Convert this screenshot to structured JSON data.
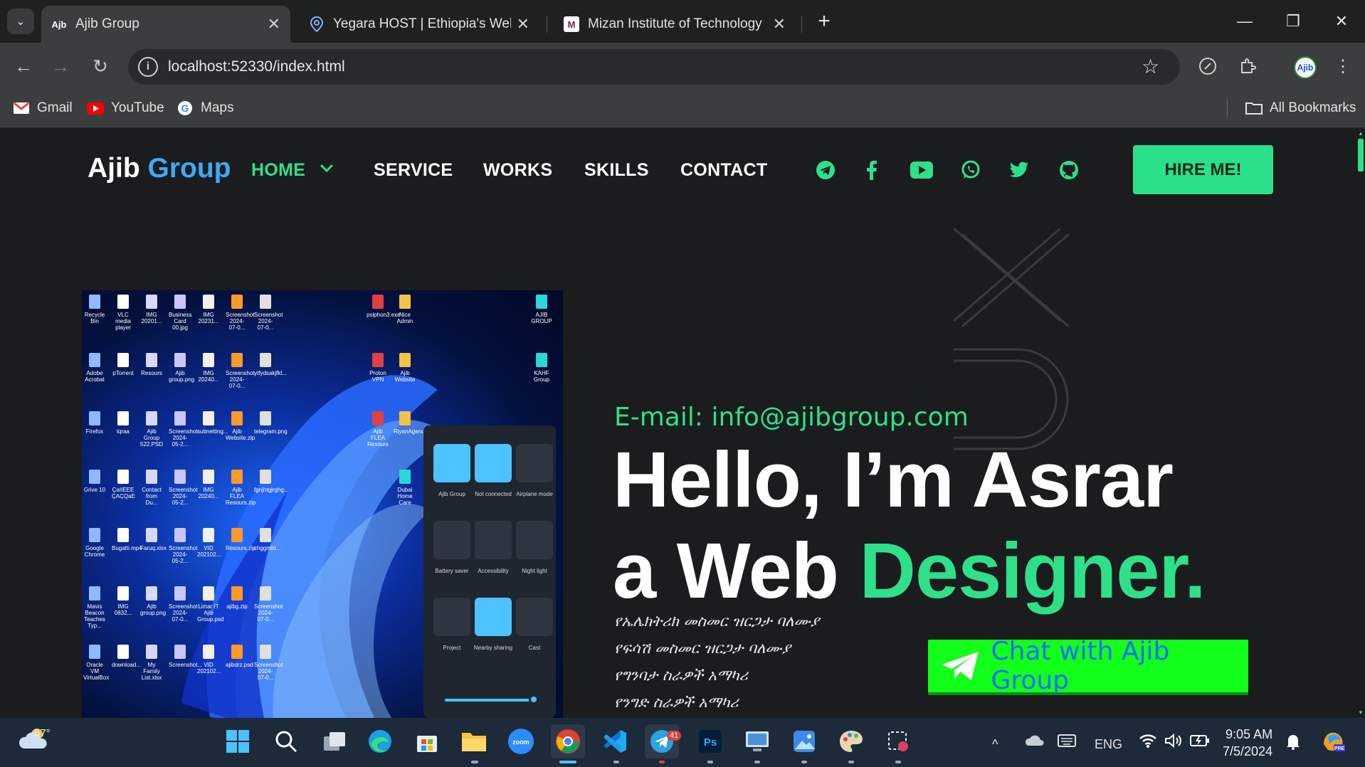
{
  "browser": {
    "tabs": [
      {
        "title": "Ajib Group",
        "active": true,
        "favicon": "ajib-favicon"
      },
      {
        "title": "Yegara HOST | Ethiopia's Web H",
        "active": false,
        "favicon": "location-pin-icon"
      },
      {
        "title": "Mizan Institute of Technology -",
        "active": false,
        "favicon": "mizan-favicon"
      }
    ],
    "url": "localhost:52330/index.html",
    "profile_label": "Ajib",
    "bookmarks": [
      {
        "label": "Gmail",
        "icon": "gmail-icon"
      },
      {
        "label": "YouTube",
        "icon": "youtube-icon"
      },
      {
        "label": "Maps",
        "icon": "google-icon"
      }
    ],
    "all_bookmarks": "All Bookmarks"
  },
  "site": {
    "logo_main": "Ajib",
    "logo_accent": "Group",
    "nav": [
      "HOME",
      "SERVICE",
      "WORKS",
      "SKILLS",
      "CONTACT"
    ],
    "social_icons": [
      "telegram-icon",
      "facebook-icon",
      "youtube-icon",
      "whatsapp-icon",
      "twitter-icon",
      "github-icon"
    ],
    "hire_button": "HIRE ME!",
    "email": "E-mail: info@ajibgroup.com",
    "hero_line1": "Hello, I’m Asrar",
    "hero_line2_a": "a Web ",
    "hero_line2_b": "Designer.",
    "services": [
      "የኤሌክትሪክ መስመር ዝርጋታ ባለሙያ",
      "የፍሳሽ መስመር ዝርጋታ ባለሙያ",
      "የግንባታ ስራዎች አማካሪ",
      "የንግድ ስራዎች አማካሪ"
    ],
    "chat_button": "Chat with Ajib Group",
    "accent_color": "#2fe08a",
    "logo_accent_color": "#3fa9f5"
  },
  "desktop_screenshot": {
    "icons": [
      {
        "label": "Recycle Bin"
      },
      {
        "label": "VLC media player"
      },
      {
        "label": "IMG 20201..."
      },
      {
        "label": "Business Card 00.jpg"
      },
      {
        "label": "IMG 20231..."
      },
      {
        "label": "Screenshot 2024-07-0..."
      },
      {
        "label": "Screenshot 2024-07-0..."
      },
      {
        "label": "Adobe Acrobat"
      },
      {
        "label": "pTorrent"
      },
      {
        "label": "Resours"
      },
      {
        "label": "Ajib group.png"
      },
      {
        "label": "IMG 20240..."
      },
      {
        "label": "Screenshot 2024-07-0..."
      },
      {
        "label": "ytfydsakjfkl..."
      },
      {
        "label": "Firefox"
      },
      {
        "label": "lqraa"
      },
      {
        "label": "Ajib Group 522.PSD"
      },
      {
        "label": "Screenshot 2024-05-2..."
      },
      {
        "label": "subnetting..."
      },
      {
        "label": "Ajib Website.zip"
      },
      {
        "label": "telegram.png"
      },
      {
        "label": "Grive 10"
      },
      {
        "label": "ÇaIIEEE ÇAÇQaE"
      },
      {
        "label": "Contact from Du..."
      },
      {
        "label": "Screenshot 2024-05-2..."
      },
      {
        "label": "IMG 20240..."
      },
      {
        "label": "Ajib FLEA Resours.zip"
      },
      {
        "label": "fgnjhtgjrghg..."
      },
      {
        "label": "Google Chrome"
      },
      {
        "label": "Bugatti.mp4"
      },
      {
        "label": "Faruq.xlsx"
      },
      {
        "label": "Screenshot 2024-05-2..."
      },
      {
        "label": "VID 202102..."
      },
      {
        "label": "Resours.zip"
      },
      {
        "label": "chggmbt..."
      },
      {
        "label": "Mavis Beacon Teaches Typ..."
      },
      {
        "label": "IMG 0832..."
      },
      {
        "label": "Ajib group.png"
      },
      {
        "label": "Screenshot 2024-07-0..."
      },
      {
        "label": "Limar IT Ajib Group.psd"
      },
      {
        "label": "ajibg.zip"
      },
      {
        "label": "Screenshot 2024-07-0..."
      },
      {
        "label": "Oracle VM VirtualBox"
      },
      {
        "label": "download..."
      },
      {
        "label": "My Family List.xlsx"
      },
      {
        "label": "Screenshot..."
      },
      {
        "label": "VID 202102..."
      },
      {
        "label": "ajibdrz.psd"
      },
      {
        "label": "Screenshot 2024-07-0..."
      }
    ],
    "right_icons": [
      {
        "label": "psiphon3.exe"
      },
      {
        "label": "Nice Admin"
      },
      {
        "label": "AJIB GROUP"
      },
      {
        "label": "Proton VPN"
      },
      {
        "label": "Ajib Website"
      },
      {
        "label": "KAHF Group"
      },
      {
        "label": "Ajib FLEA Resours"
      },
      {
        "label": "RiyanAgency"
      },
      {
        "label": "Dubai Home Care"
      }
    ],
    "quick_settings": [
      "Ajib Group",
      "Not connected",
      "Airplane mode",
      "Battery saver",
      "Accessibility",
      "Night light",
      "Project",
      "Nearby sharing",
      "Cast"
    ]
  },
  "taskbar": {
    "weather": "57°",
    "apps": [
      "windows-start-icon",
      "search-icon",
      "task-view-icon",
      "edge-icon",
      "store-icon",
      "file-explorer-icon",
      "zoom-icon",
      "chrome-icon",
      "vscode-icon",
      "telegram-icon",
      "photoshop-icon",
      "screen-app-icon",
      "photos-icon",
      "paint-icon",
      "snipping-icon"
    ],
    "telegram_badge": "41",
    "language": "ENG",
    "time": "9:05 AM",
    "date": "7/5/2024"
  }
}
